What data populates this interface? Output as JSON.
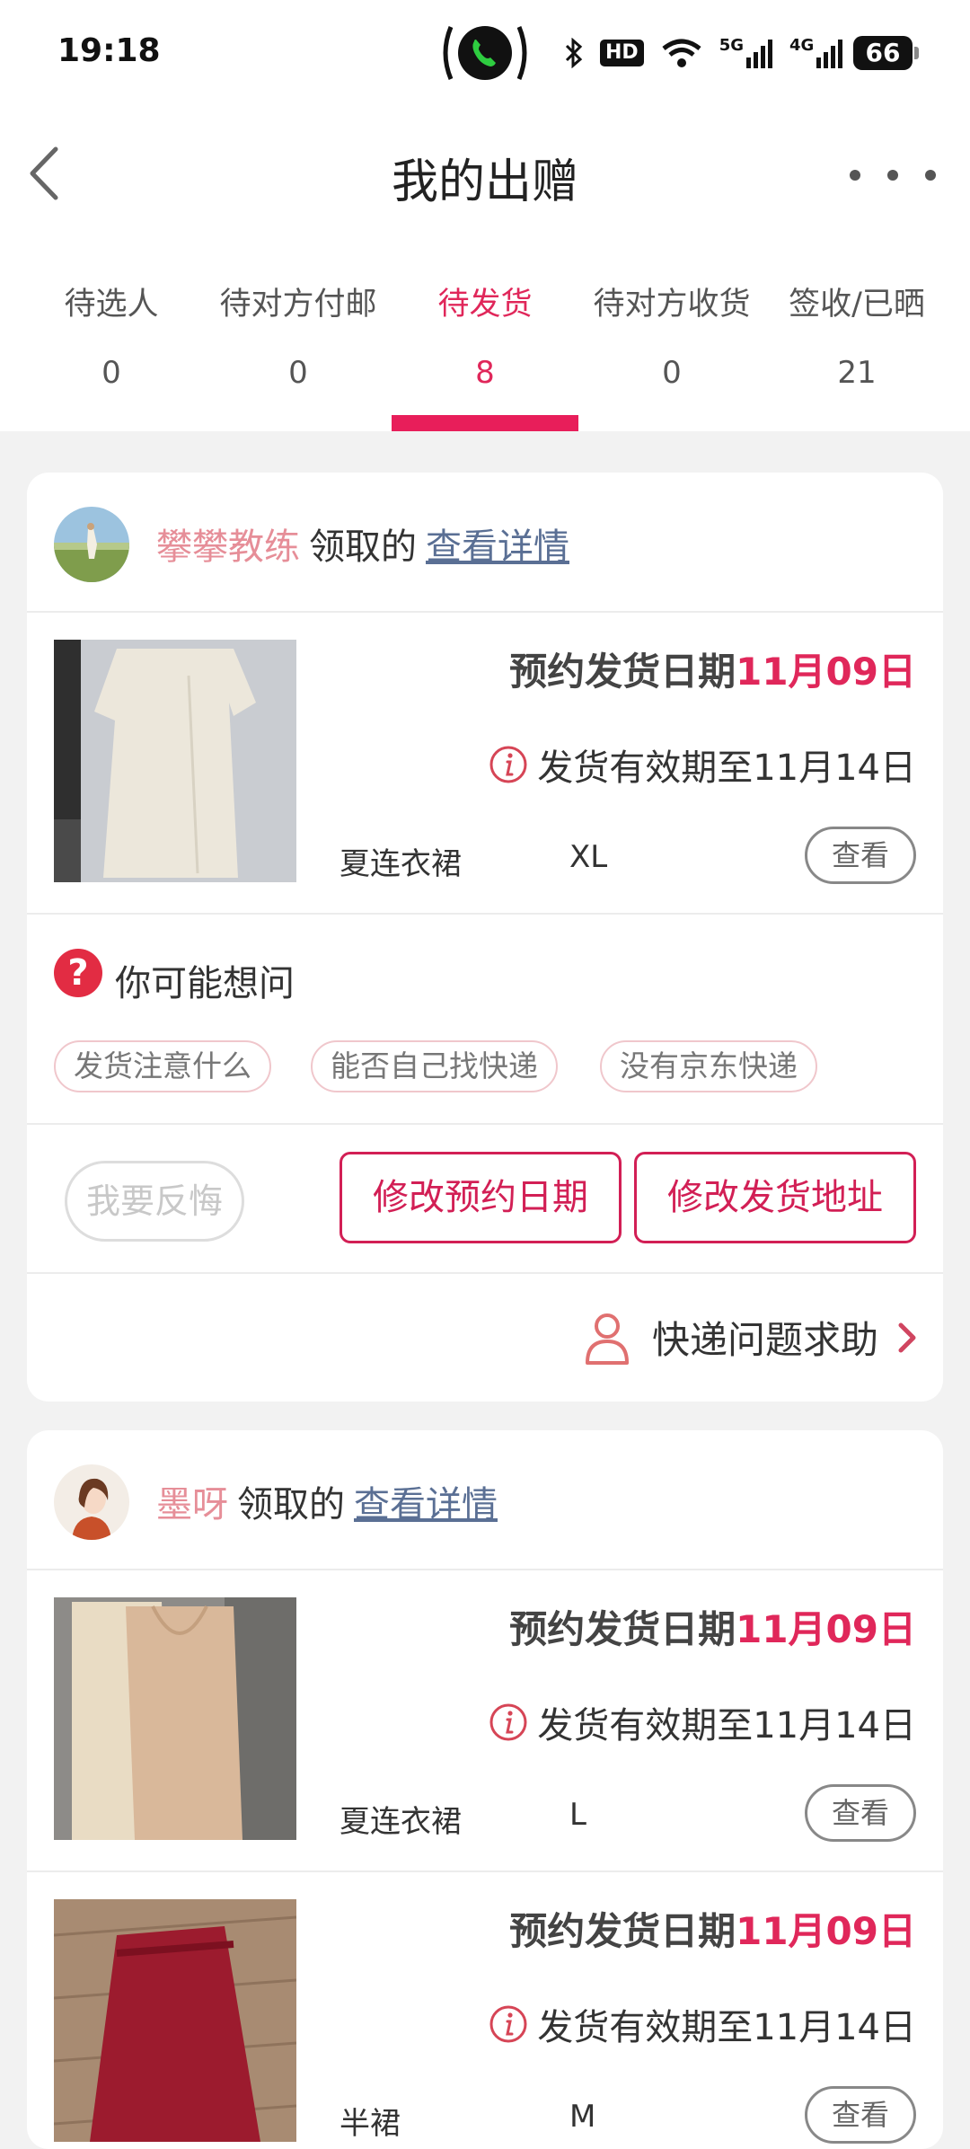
{
  "status_bar": {
    "time": "19:18",
    "icons": [
      "call-icon",
      "bluetooth-icon",
      "hd-icon",
      "wifi-icon",
      "signal-5g-icon",
      "signal-4g-icon"
    ],
    "hd_label": "HD",
    "net_5g": "5G",
    "net_4g": "4G",
    "battery": "66"
  },
  "header": {
    "title": "我的出赠"
  },
  "tabs": [
    {
      "label": "待选人",
      "count": "0"
    },
    {
      "label": "待对方付邮",
      "count": "0"
    },
    {
      "label": "待发货",
      "count": "8"
    },
    {
      "label": "待对方收货",
      "count": "0"
    },
    {
      "label": "签收/已晒",
      "count": "21"
    }
  ],
  "active_tab": 2,
  "colors": {
    "accent": "#e0275a",
    "claimer": "#e68e98",
    "link": "#5a6f94"
  },
  "cards": [
    {
      "claimer": "攀攀教练",
      "claim_word": "领取的",
      "detail_link": "查看详情",
      "items": [
        {
          "ship_label": "预约发货日期",
          "ship_date": "11月09日",
          "valid_text": "发货有效期至11月14日",
          "name": "夏连衣裙",
          "size": "XL",
          "view": "查看"
        }
      ],
      "faq": {
        "title": "你可能想问",
        "chips": [
          "发货注意什么",
          "能否自己找快递",
          "没有京东快递"
        ]
      },
      "actions": {
        "regret": "我要反悔",
        "change_date": "修改预约日期",
        "change_address": "修改发货地址"
      },
      "help": "快递问题求助"
    },
    {
      "claimer": "墨呀",
      "claim_word": "领取的",
      "detail_link": "查看详情",
      "items": [
        {
          "ship_label": "预约发货日期",
          "ship_date": "11月09日",
          "valid_text": "发货有效期至11月14日",
          "name": "夏连衣裙",
          "size": "L",
          "view": "查看"
        },
        {
          "ship_label": "预约发货日期",
          "ship_date": "11月09日",
          "valid_text": "发货有效期至11月14日",
          "name": "半裙",
          "size": "M",
          "view": "查看"
        }
      ]
    }
  ]
}
